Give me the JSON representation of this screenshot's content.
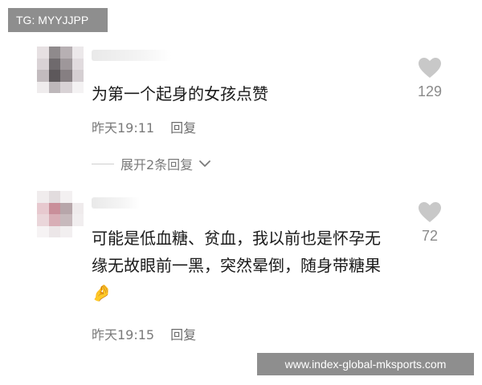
{
  "badge": {
    "text": "TG: MYYJJPP"
  },
  "comments": [
    {
      "text": "为第一个起身的女孩点赞",
      "time": "昨天19:11",
      "reply_label": "回复",
      "likes": "129",
      "expand_label": "展开2条回复"
    },
    {
      "text": "可能是低血糖、贫血，我以前也是怀孕无缘无故眼前一黑，突然晕倒，随身带糖果🤌",
      "time": "昨天19:15",
      "reply_label": "回复",
      "likes": "72"
    }
  ],
  "watermark": {
    "text": "www.index-global-mksports.com"
  },
  "colors": {
    "heart": "#c8c8c8",
    "meta_text": "#7a7a7a",
    "main_text": "#1a1a1a"
  },
  "icons": {
    "like": "heart-icon",
    "expand": "chevron-down-icon"
  }
}
